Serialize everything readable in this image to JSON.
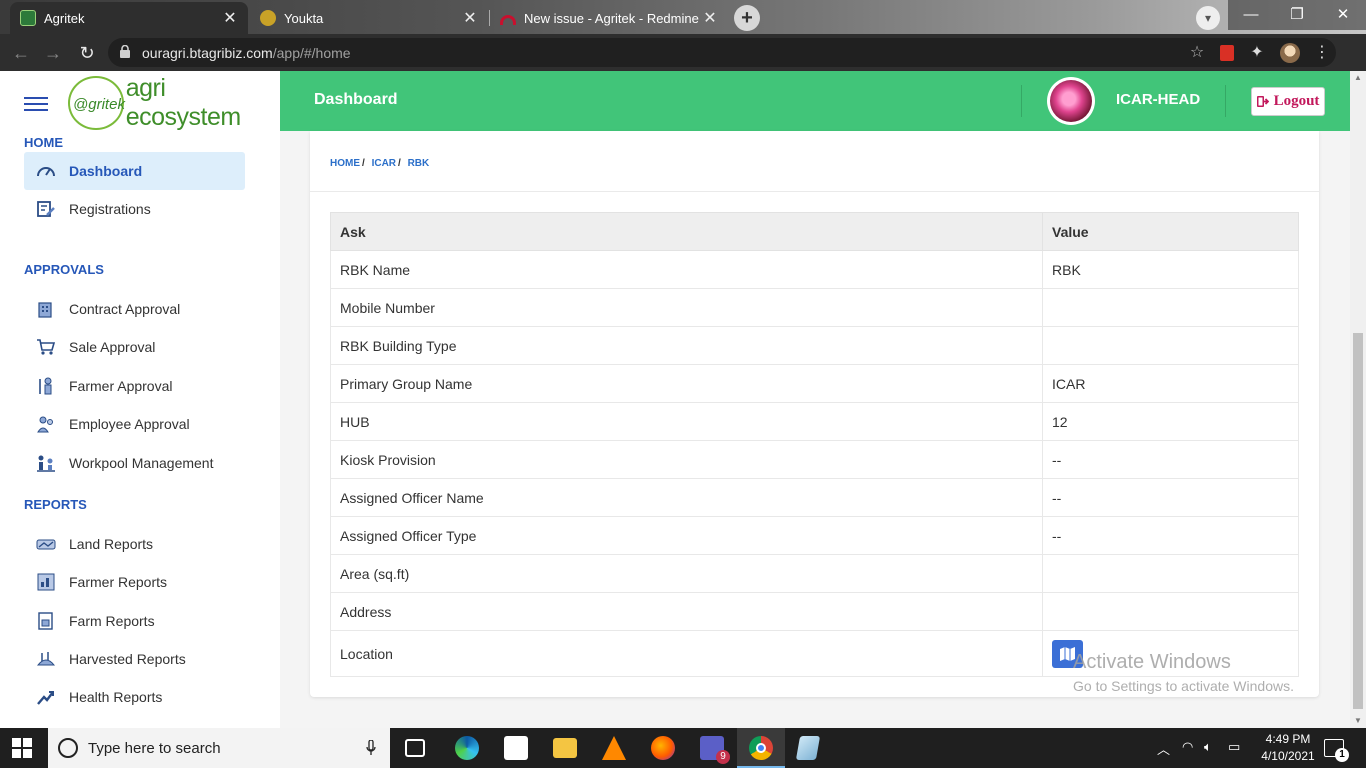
{
  "browser": {
    "tabs": [
      {
        "title": "Agritek",
        "active": true
      },
      {
        "title": "Youkta",
        "active": false
      },
      {
        "title": "New issue - Agritek - Redmine",
        "active": false
      }
    ],
    "url_host": "ouragri.btagribiz.com",
    "url_path": "/app/#/home"
  },
  "sidebar": {
    "logo_mark": "@gritek",
    "logo_text": "agri ecosystem",
    "sections": [
      {
        "title": "HOME",
        "items": [
          "Dashboard",
          "Registrations"
        ]
      },
      {
        "title": "APPROVALS",
        "items": [
          "Contract Approval",
          "Sale Approval",
          "Farmer Approval",
          "Employee Approval",
          "Workpool Management"
        ]
      },
      {
        "title": "REPORTS",
        "items": [
          "Land Reports",
          "Farmer Reports",
          "Farm Reports",
          "Harvested Reports",
          "Health Reports"
        ]
      }
    ],
    "active_item": "Dashboard"
  },
  "header": {
    "title": "Dashboard",
    "user_name": "ICAR-HEAD",
    "logout_label": "Logout"
  },
  "breadcrumb": [
    "HOME",
    "ICAR",
    "RBK"
  ],
  "table": {
    "headers": [
      "Ask",
      "Value"
    ],
    "rows": [
      {
        "ask": "RBK Name",
        "value": "RBK"
      },
      {
        "ask": "Mobile Number",
        "value": ""
      },
      {
        "ask": "RBK Building Type",
        "value": ""
      },
      {
        "ask": "Primary Group Name",
        "value": "ICAR"
      },
      {
        "ask": "HUB",
        "value": "12"
      },
      {
        "ask": "Kiosk Provision",
        "value": "--"
      },
      {
        "ask": "Assigned Officer Name",
        "value": "--"
      },
      {
        "ask": "Assigned Officer Type",
        "value": "--"
      },
      {
        "ask": "Area (sq.ft)",
        "value": ""
      },
      {
        "ask": "Address",
        "value": ""
      },
      {
        "ask": "Location",
        "value": ""
      }
    ]
  },
  "watermark": {
    "line1": "Activate Windows",
    "line2": "Go to Settings to activate Windows."
  },
  "taskbar": {
    "search_placeholder": "Type here to search",
    "time": "4:49 PM",
    "date": "4/10/2021",
    "teams_badge": "9",
    "notification_count": "1"
  },
  "colors": {
    "topbar": "#41c579",
    "accent_blue": "#2657b8",
    "logout_text": "#c2185b",
    "map_button": "#3b6fd6"
  }
}
